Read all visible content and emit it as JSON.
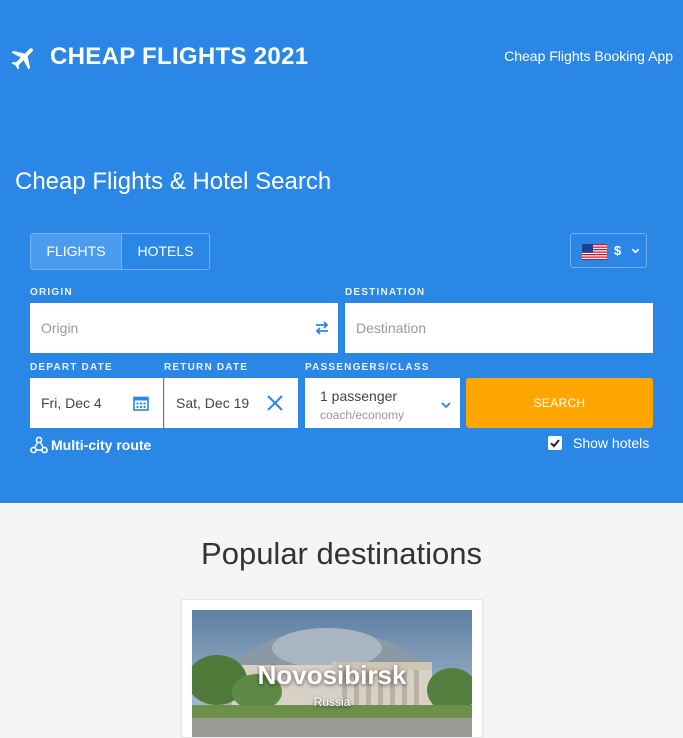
{
  "header": {
    "brand": "CHEAP FLIGHTS 2021",
    "app_name": "Cheap Flights Booking App",
    "logo_icon": "airplane-icon"
  },
  "search": {
    "headline": "Cheap Flights & Hotel Search",
    "tabs": [
      {
        "label": "FLIGHTS",
        "active": true
      },
      {
        "label": "HOTELS",
        "active": false
      }
    ],
    "currency": {
      "flag": "us-flag-icon",
      "symbol": "$"
    },
    "origin": {
      "label": "ORIGIN",
      "placeholder": "Origin"
    },
    "destination": {
      "label": "DESTINATION",
      "placeholder": "Destination"
    },
    "depart": {
      "label": "DEPART DATE",
      "value": "Fri, Dec 4"
    },
    "return": {
      "label": "RETURN DATE",
      "value": "Sat, Dec 19"
    },
    "passengers": {
      "label": "PASSENGERS/CLASS",
      "count": "1 passenger",
      "class": "coach/economy"
    },
    "search_button": "SEARCH",
    "multi_city": "Multi-city route",
    "show_hotels": {
      "label": "Show hotels",
      "checked": true
    },
    "colors": {
      "hero_bg": "#2a87e6",
      "search_button": "#ffa600"
    }
  },
  "popular": {
    "title": "Popular destinations",
    "items": [
      {
        "city": "Novosibirsk",
        "country": "Russia"
      }
    ]
  }
}
